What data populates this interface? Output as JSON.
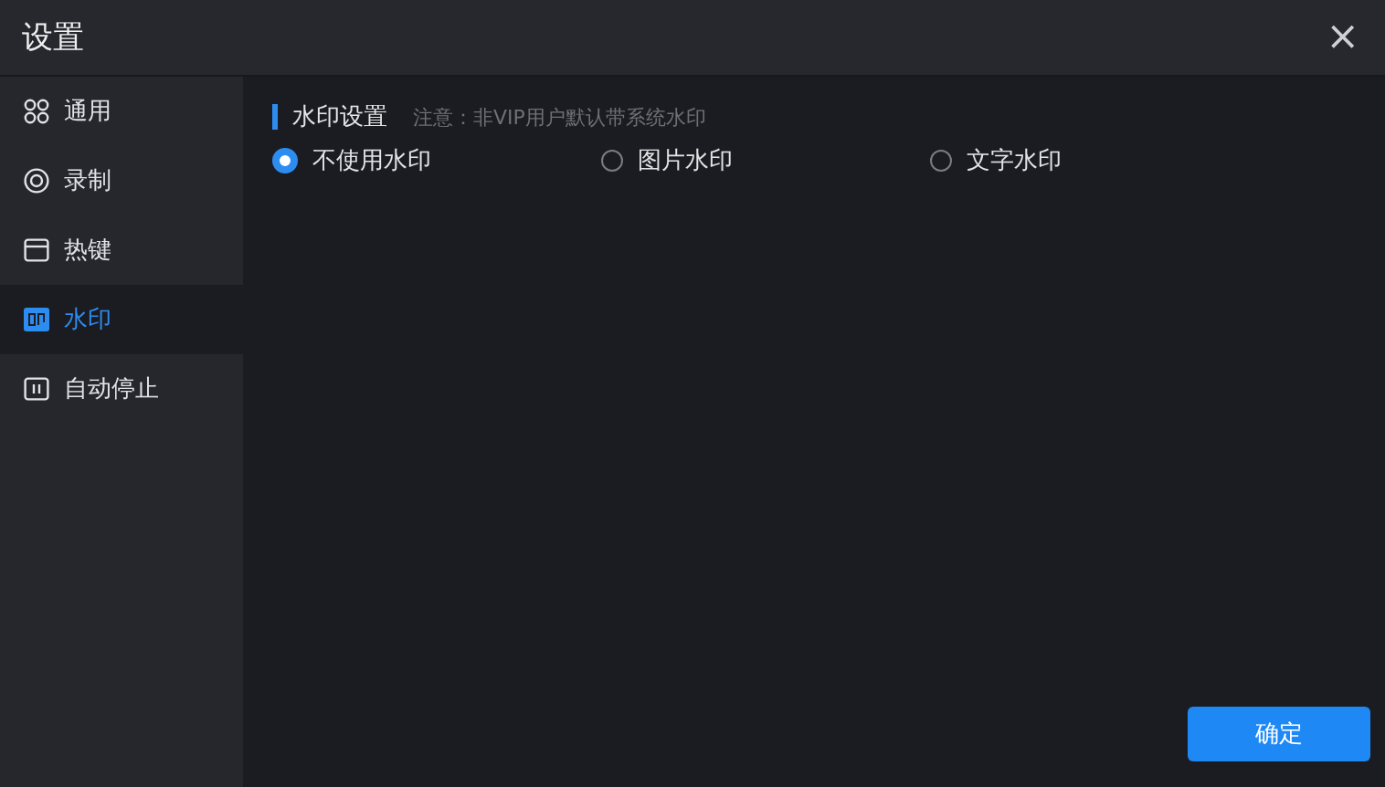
{
  "window": {
    "title": "设置",
    "close": "×"
  },
  "sidebar": {
    "items": [
      {
        "label": "通用",
        "selected": false
      },
      {
        "label": "录制",
        "selected": false
      },
      {
        "label": "热键",
        "selected": false
      },
      {
        "label": "水印",
        "selected": true
      },
      {
        "label": "自动停止",
        "selected": false
      }
    ]
  },
  "section": {
    "title": "水印设置",
    "note": "注意：非VIP用户默认带系统水印"
  },
  "options": [
    {
      "label": "不使用水印",
      "selected": true
    },
    {
      "label": "图片水印",
      "selected": false
    },
    {
      "label": "文字水印",
      "selected": false
    }
  ],
  "buttons": [
    "确定"
  ]
}
